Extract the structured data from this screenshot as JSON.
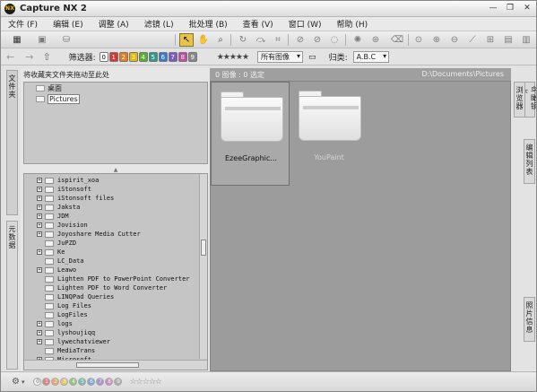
{
  "window": {
    "title": "Capture NX 2"
  },
  "menu": [
    {
      "label": "文件 (F)"
    },
    {
      "label": "编辑 (E)"
    },
    {
      "label": "调整 (A)"
    },
    {
      "label": "滤镜 (L)"
    },
    {
      "label": "批处理 (B)"
    },
    {
      "label": "查看 (V)"
    },
    {
      "label": "窗口 (W)"
    },
    {
      "label": "帮助 (H)"
    }
  ],
  "filterbar": {
    "label": "筛选器:",
    "numbers": [
      "0",
      "1",
      "2",
      "3",
      "4",
      "5",
      "6",
      "7",
      "8",
      "9"
    ],
    "number_colors": [
      "#ffffff",
      "#d33",
      "#e87a20",
      "#e6b800",
      "#58b030",
      "#2a9a8a",
      "#3a78d0",
      "#7a5ac8",
      "#c24aa0",
      "#888888"
    ],
    "stars": "★★★★★",
    "view_select": "所有图像",
    "sort_label": "归类:",
    "sort_select": "A.B.C"
  },
  "left_tabs": {
    "folders": "文件夹",
    "metadata": "元数据"
  },
  "right_tabs": {
    "browser": "浏览器",
    "birdseye": "鸟瞰镜头",
    "edit_list": "编辑列表",
    "photo_info": "照片信息"
  },
  "favorites": {
    "header": "将收藏夹文件夹拖动至此处",
    "items": [
      {
        "label": "桌面"
      },
      {
        "label": "Pictures"
      }
    ]
  },
  "tree": {
    "items": [
      {
        "label": "ispirit_xoa",
        "expandable": true
      },
      {
        "label": "iStonsoft",
        "expandable": true
      },
      {
        "label": "iStonsoft files",
        "expandable": true
      },
      {
        "label": "Jaksta",
        "expandable": true
      },
      {
        "label": "JDM",
        "expandable": true
      },
      {
        "label": "Jovision",
        "expandable": true
      },
      {
        "label": "Joyoshare Media Cutter",
        "expandable": true
      },
      {
        "label": "JuPZD",
        "expandable": false
      },
      {
        "label": "Ke",
        "expandable": true
      },
      {
        "label": "LC_Data",
        "expandable": false
      },
      {
        "label": "Leawo",
        "expandable": true
      },
      {
        "label": "Lighten PDF to PowerPoint Converter",
        "expandable": false
      },
      {
        "label": "Lighten PDF to Word Converter",
        "expandable": false
      },
      {
        "label": "LINQPad Queries",
        "expandable": false
      },
      {
        "label": "Log Files",
        "expandable": false
      },
      {
        "label": "LogFiles",
        "expandable": false
      },
      {
        "label": "logs",
        "expandable": true
      },
      {
        "label": "lyshoujiqq",
        "expandable": true
      },
      {
        "label": "lywechatviewer",
        "expandable": true
      },
      {
        "label": "MediaTrans",
        "expandable": false
      },
      {
        "label": "Microsoft",
        "expandable": true
      }
    ]
  },
  "content": {
    "status": "0 图像 : 0 选定",
    "path": "D:\\Documents\\Pictures",
    "folders": [
      {
        "label": "EzeeGraphic...",
        "selected": true
      },
      {
        "label": "YouPaint",
        "selected": false
      }
    ]
  },
  "statusbar": {
    "numbers": [
      "0",
      "1",
      "2",
      "3",
      "4",
      "5",
      "6",
      "7",
      "8",
      "9"
    ],
    "stars": "☆☆☆☆☆"
  }
}
